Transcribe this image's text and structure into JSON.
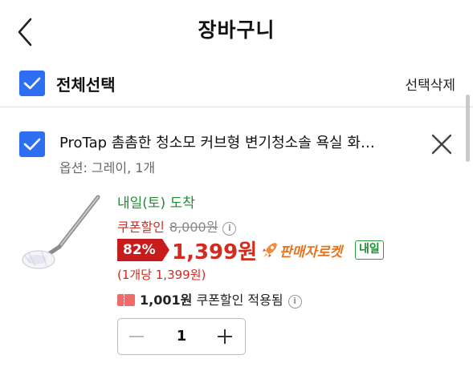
{
  "header": {
    "title": "장바구니",
    "back_icon": "chevron-left-icon"
  },
  "select_all": {
    "label": "전체선택",
    "checked": true,
    "delete_label": "선택삭제"
  },
  "item": {
    "checked": true,
    "name": "ProTap 촘촘한 청소모 커브형 변기청소솔 욕실 화…",
    "option": "옵션: 그레이, 1개",
    "delivery": "내일(토) 도착",
    "coupon_label": "쿠폰할인",
    "original_price": "8,000원",
    "discount": "82%",
    "sale_price": "1,399원",
    "seller_rocket": "판매자로켓",
    "tomorrow_badge": "내일",
    "unit_price": "(1개당 1,399원)",
    "coupon_amount": "1,001원",
    "coupon_applied_text": "쿠폰할인 적용됨",
    "quantity": "1"
  },
  "colors": {
    "accent": "#2e6ff2",
    "price_red": "#d52b1e",
    "delivery_green": "#1e8c30",
    "rocket_orange": "#e8731e"
  }
}
